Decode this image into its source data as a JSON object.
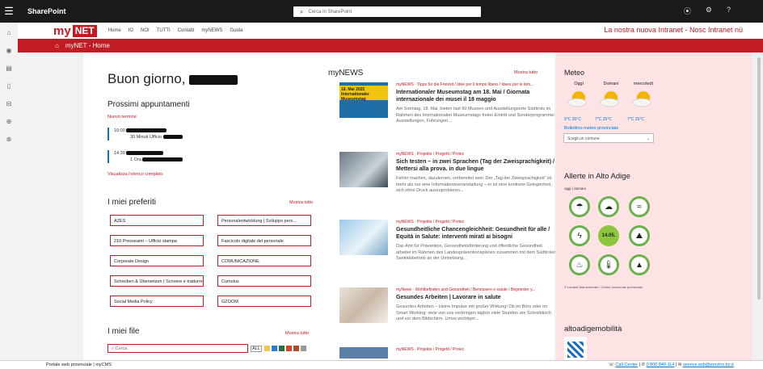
{
  "suite": {
    "app_title": "SharePoint",
    "search_placeholder": "Cerca in SharePoint"
  },
  "nav": {
    "items": [
      "Home",
      "IO",
      "NOI",
      "TUTTI",
      "Contatti",
      "myNEWS",
      "Guida"
    ],
    "tagline": "La nostra nuova Intranet - Nosc Intranet nü"
  },
  "page": {
    "title": "myNET - Home"
  },
  "greeting": "Buon giorno,",
  "appointments": {
    "title": "Prossimi appuntamenti",
    "new_link": "Nuovo termine",
    "items": [
      {
        "time": "10:00",
        "detail": "30 Minuti  Ufficio"
      },
      {
        "time": "14:30",
        "detail": "1 Ora"
      }
    ],
    "calendar_link": "Visualizza l'elenco completo"
  },
  "favorites": {
    "title": "I miei preferiti",
    "show_all": "Mostra tutto",
    "items": [
      "AZES",
      "Personalentwicklung | Sviluppo pers...",
      "210 Presseamt – Ufficio stampa",
      "Fascicolo digitale del personale",
      "Corporate Design",
      "COMUNICAZIONE",
      "Schreiben & Übersetzen | Scrivere e tradurre",
      "Cumulus",
      "Social Media Policy",
      "GZOOM"
    ]
  },
  "files": {
    "title": "I miei file",
    "show_all": "Mostra tutto",
    "search_placeholder": "Cerca",
    "filter": "ALL"
  },
  "news": {
    "title": "myNEWS",
    "show_all": "Mostra tutto",
    "thumb_label": "18. Mai 2025\nInternationaler Museumstag",
    "items": [
      {
        "category": "myNEWS · Tipps für die Freizeit / Idee per il tempo libero / Idees por le tëm...",
        "title": "Internationaler Museumstag am 18. Mai / Giornata internazionale dei musei il 18 maggio",
        "desc": "Am Sonntag, 18. Mai, bieten fast 60 Museen und Ausstellungsorte Südtirols im Rahmen des Internationalen Museumstags freien Eintritt und Sonderprogramme: Ausstellungen, Führungen..."
      },
      {
        "category": "myNEWS · Projekte / Progetti / Proiec",
        "title": "Sich testen – in zwei Sprachen (Tag der Zweisprachigkeit) / Mettersi alla prova. in due lingue",
        "desc": "Fehler machen, dazulernen, vorbereitet sein: Der „Tag der Zweisprachigkeit“ ist mehr als nur eine Informationsveranstaltung – er ist eine konkrete Gelegenheit, sich ohne Druck auszuprobieren..."
      },
      {
        "category": "myNEWS · Projekte / Progetti / Proiec",
        "title": "Gesundheitliche Chancengleichheit: Gesundheit für alle / Equità in Salute: interventi mirati ai bisogni",
        "desc": "Das Amt für Prävention, Gesundheitsförderung und öffentliche Gesundheit arbeitet im Rahmen des Landespräventionsplanes zusammen mit dem Südtiroler Sanitätsbetrieb an der Umsetzung..."
      },
      {
        "category": "myNews · Wohlbefinden und Gesundheit / Benessere e salute / Bëgnester y...",
        "title": "Gesundes Arbeiten | Lavorare in salute",
        "desc": "Gesundes Arbeiten – kleine Impulse mit großer Wirkung! Ob im Büro oder im Smart Working: viele von uns verbringen täglich viele Stunden am Schreibtisch und vor dem Bildschirm. Umso wichtiger..."
      },
      {
        "category": "myNEWS · Projekte / Progetti / Proiec"
      }
    ]
  },
  "meteo": {
    "title": "Meteo",
    "days": [
      "Oggi",
      "Domani",
      "mercoledì"
    ],
    "temps": [
      "9°C  26°C",
      "7°C  25°C",
      "7°C  25°C"
    ],
    "forecast_link": "Bollettino meteo provinciale",
    "select_placeholder": "Scegli un comune"
  },
  "alerts": {
    "title": "Allerte in Alto Adige",
    "subtitle": "oggi | domani",
    "date": "14.05.",
    "icons": [
      "rain-icon",
      "storm-icon",
      "wind-icon",
      "thunder-icon",
      "date",
      "avalanche-icon",
      "fire-icon",
      "temperature-icon",
      "forest-fire-icon"
    ],
    "credit": "© Landes-Warnzentrale / Centro funzionale provinciale"
  },
  "altoadige": {
    "title": "altoadigemobilità"
  },
  "footer": {
    "left": "Portale web provinciale | myCMS",
    "callcenter": "Call Center",
    "phone": "0 800 840 114",
    "email": "service.asb@provinz.bz.it"
  },
  "colors": {
    "brand_red": "#c11b24",
    "alert_green": "#6ab04c",
    "link_blue": "#0078d4",
    "suite_bar": "#1b1a19"
  }
}
